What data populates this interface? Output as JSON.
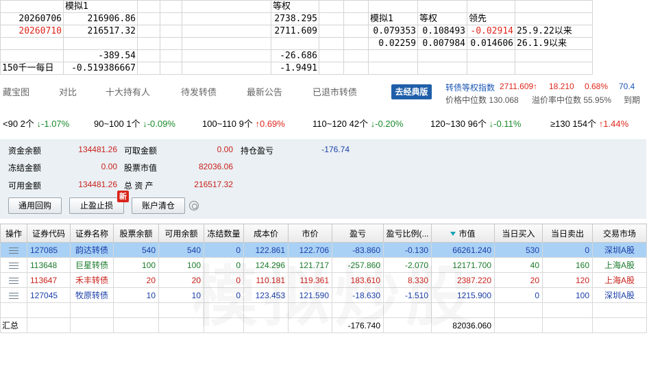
{
  "sheet": {
    "rows": [
      [
        "",
        "模拟1",
        "",
        "",
        "",
        "等权",
        "",
        "",
        "",
        "",
        "",
        ""
      ],
      [
        "20260706",
        "216906.86",
        "",
        "",
        "",
        "2738.295",
        "",
        "",
        "模拟1",
        "等权",
        "领先",
        ""
      ],
      [
        "20260710",
        "216517.32",
        "",
        "",
        "",
        "2711.609",
        "",
        "",
        "0.079353",
        "0.108493",
        "-0.02914",
        "25.9.22以来"
      ],
      [
        "",
        "",
        "",
        "",
        "",
        "",
        "",
        "",
        "0.02259",
        "0.007984",
        "0.014606",
        "26.1.9以来"
      ],
      [
        "",
        "-389.54",
        "",
        "",
        "",
        "-26.686",
        "",
        "",
        "",
        "",
        "",
        ""
      ],
      [
        "150千一每日",
        "-0.519386667",
        "",
        "",
        "",
        "-1.9491",
        "",
        "",
        "",
        "",
        "",
        ""
      ]
    ]
  },
  "tabs": {
    "items": [
      "藏宝图",
      "对比",
      "十大持有人",
      "待发转债",
      "最新公告",
      "已退市转债"
    ],
    "classic_button": "去经典版",
    "index_label": "转债等权指数",
    "index_value": "2711.609↑",
    "index_change": "18.210",
    "index_pct": "0.68%",
    "index_extra": "70.4",
    "median_price": "价格中位数 130.068",
    "median_premium": "溢价率中位数 55.95%",
    "arrive": "到期"
  },
  "buckets": [
    {
      "range": "<90 2个",
      "change": "↓-1.07%",
      "dir": "down"
    },
    {
      "range": "90~100 1个",
      "change": "↓-0.09%",
      "dir": "down"
    },
    {
      "range": "100~110 9个",
      "change": "↑0.69%",
      "dir": "up"
    },
    {
      "range": "110~120 42个",
      "change": "↓-0.20%",
      "dir": "down"
    },
    {
      "range": "120~130 96个",
      "change": "↓-0.11%",
      "dir": "down"
    },
    {
      "range": "≥130 154个",
      "change": "↑1.44%",
      "dir": "up"
    }
  ],
  "account": {
    "cash_label": "资金余额",
    "cash": "134481.26",
    "withdrawable_label": "可取金额",
    "withdrawable": "0.00",
    "pnl_label": "持仓盈亏",
    "pnl": "-176.74",
    "frozen_label": "冻结金额",
    "frozen": "0.00",
    "stock_value_label": "股票市值",
    "stock_value": "82036.06",
    "available_label": "可用金额",
    "available": "134481.26",
    "total_label": "总 资 产",
    "total": "216517.32",
    "btn_repo": "通用回购",
    "btn_stop": "止盈止损",
    "btn_clear": "账户清仓",
    "new_badge": "新"
  },
  "grid": {
    "headers": [
      "操作",
      "证券代码",
      "证券名称",
      "股票余额",
      "可用余额",
      "冻结数量",
      "成本价",
      "市价",
      "盈亏",
      "盈亏比例(...",
      "市值",
      "当日买入",
      "当日卖出",
      "交易市场"
    ],
    "rows": [
      {
        "code": "127085",
        "name": "韵达转债",
        "qty": "540",
        "avail": "540",
        "frozen": "0",
        "cost": "122.861",
        "price": "122.706",
        "pnl": "-83.860",
        "pnl_pct": "-0.130",
        "value": "66261.240",
        "buy": "530",
        "sell": "0",
        "market": "深圳A股",
        "color": "bl",
        "selected": true
      },
      {
        "code": "113648",
        "name": "巨星转债",
        "qty": "100",
        "avail": "100",
        "frozen": "0",
        "cost": "124.296",
        "price": "121.717",
        "pnl": "-257.860",
        "pnl_pct": "-2.070",
        "value": "12171.700",
        "buy": "40",
        "sell": "160",
        "market": "上海A股",
        "color": "gn",
        "selected": false
      },
      {
        "code": "113647",
        "name": "禾丰转债",
        "qty": "20",
        "avail": "20",
        "frozen": "0",
        "cost": "110.181",
        "price": "119.361",
        "pnl": "183.610",
        "pnl_pct": "8.330",
        "value": "2387.220",
        "buy": "20",
        "sell": "120",
        "market": "上海A股",
        "color": "rd",
        "selected": false
      },
      {
        "code": "127045",
        "name": "牧原转债",
        "qty": "10",
        "avail": "10",
        "frozen": "0",
        "cost": "123.453",
        "price": "121.590",
        "pnl": "-18.630",
        "pnl_pct": "-1.510",
        "value": "1215.900",
        "buy": "0",
        "sell": "100",
        "market": "深圳A股",
        "color": "bl",
        "selected": false
      }
    ],
    "total_label": "汇总",
    "total_pnl": "-176.740",
    "total_value": "82036.060"
  },
  "watermark": "模拟炒股"
}
